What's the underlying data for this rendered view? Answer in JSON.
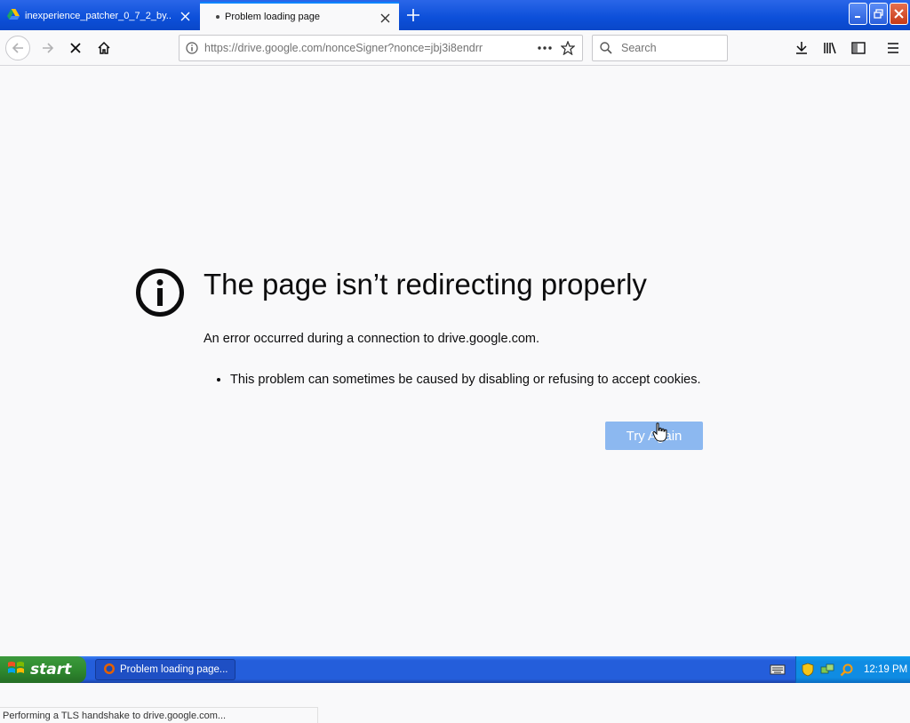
{
  "tabs": [
    {
      "title": "inexperience_patcher_0_7_2_by...",
      "icon": "google-drive-icon",
      "active": false
    },
    {
      "title": "Problem loading page",
      "icon": "loading-dot",
      "active": true
    }
  ],
  "toolbar": {
    "url": "https://drive.google.com/nonceSigner?nonce=jbj3i8endrr",
    "search_placeholder": "Search"
  },
  "error": {
    "title": "The page isn’t redirecting properly",
    "description": "An error occurred during a connection to drive.google.com.",
    "bullets": [
      "This problem can sometimes be caused by disabling or refusing to accept cookies."
    ],
    "button_label": "Try Again"
  },
  "statusbar": {
    "text": "Performing a TLS handshake to drive.google.com..."
  },
  "taskbar": {
    "start_label": "start",
    "task_label": "Problem loading page...",
    "clock": "12:19 PM"
  },
  "colors": {
    "accent": "#0a84ff",
    "button": "#8cb8f0",
    "taskbar": "#245edb",
    "start": "#2f8a2f"
  }
}
